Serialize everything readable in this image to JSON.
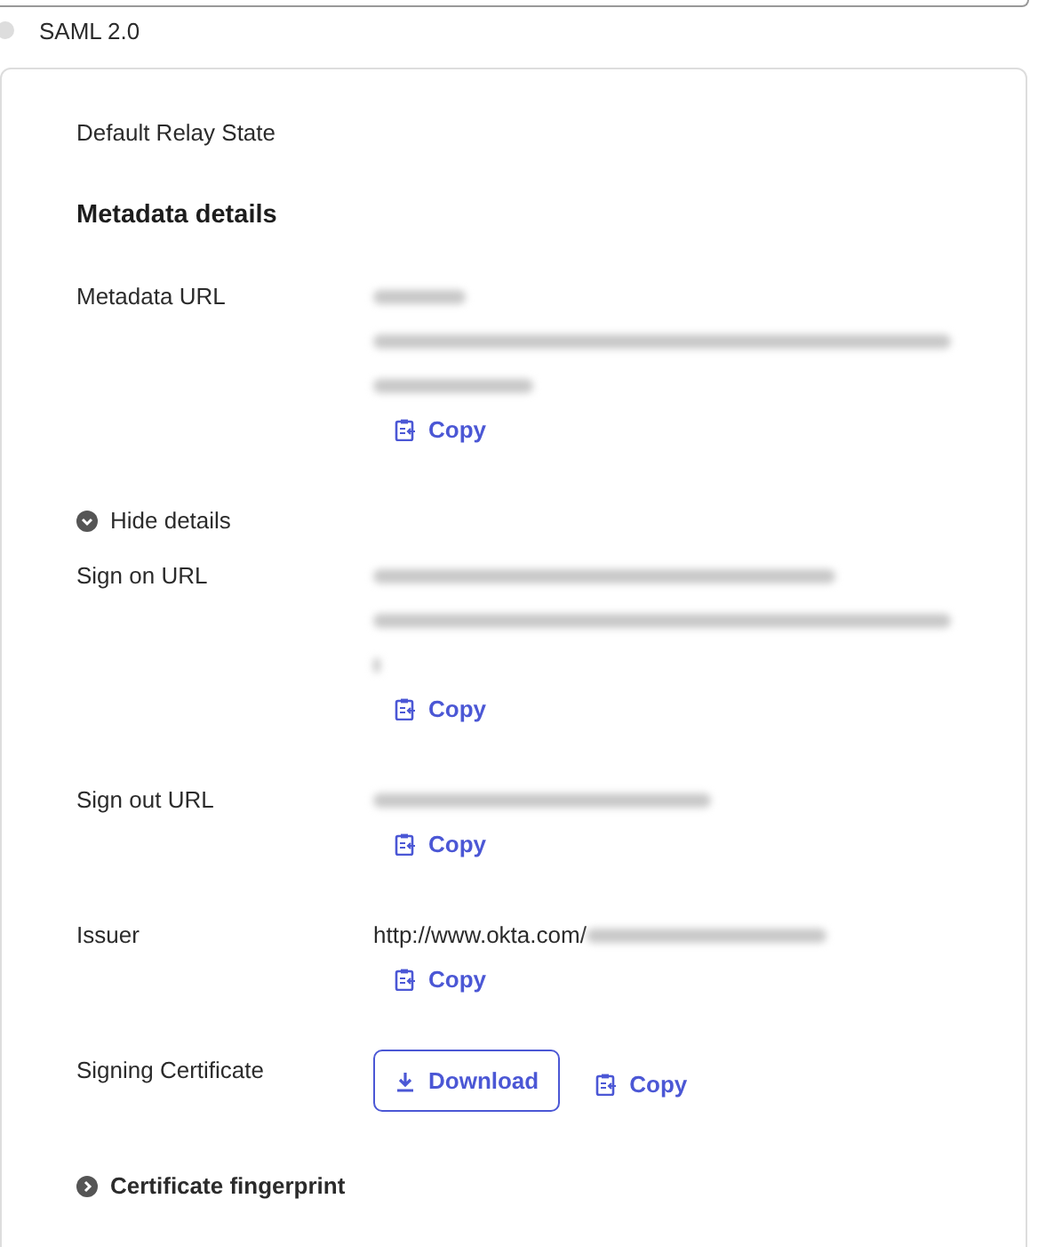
{
  "top_option": {
    "label": "SAML 2.0",
    "selected": false
  },
  "card": {
    "relay_state_label": "Default Relay State",
    "section_title": "Metadata details",
    "items": [
      {
        "kind": "field",
        "label": "Metadata URL",
        "blurred": true,
        "actions": [
          {
            "kind": "copy",
            "label": "Copy"
          }
        ]
      },
      {
        "kind": "details_toggle",
        "label": "Hide details",
        "expanded": true
      },
      {
        "kind": "field",
        "label": "Sign on URL",
        "blurred": true,
        "actions": [
          {
            "kind": "copy",
            "label": "Copy"
          }
        ]
      },
      {
        "kind": "field",
        "label": "Sign out URL",
        "blurred": true,
        "actions": [
          {
            "kind": "copy",
            "label": "Copy"
          }
        ]
      },
      {
        "kind": "field",
        "label": "Issuer",
        "value": "http://www.okta.com/",
        "blurred": true,
        "actions": [
          {
            "kind": "copy",
            "label": "Copy"
          }
        ]
      },
      {
        "kind": "field",
        "label": "Signing Certificate",
        "actions": [
          {
            "kind": "download",
            "label": "Download"
          },
          {
            "kind": "copy",
            "label": "Copy"
          }
        ]
      },
      {
        "kind": "section_toggle",
        "label": "Certificate fingerprint",
        "expanded": false
      }
    ]
  }
}
